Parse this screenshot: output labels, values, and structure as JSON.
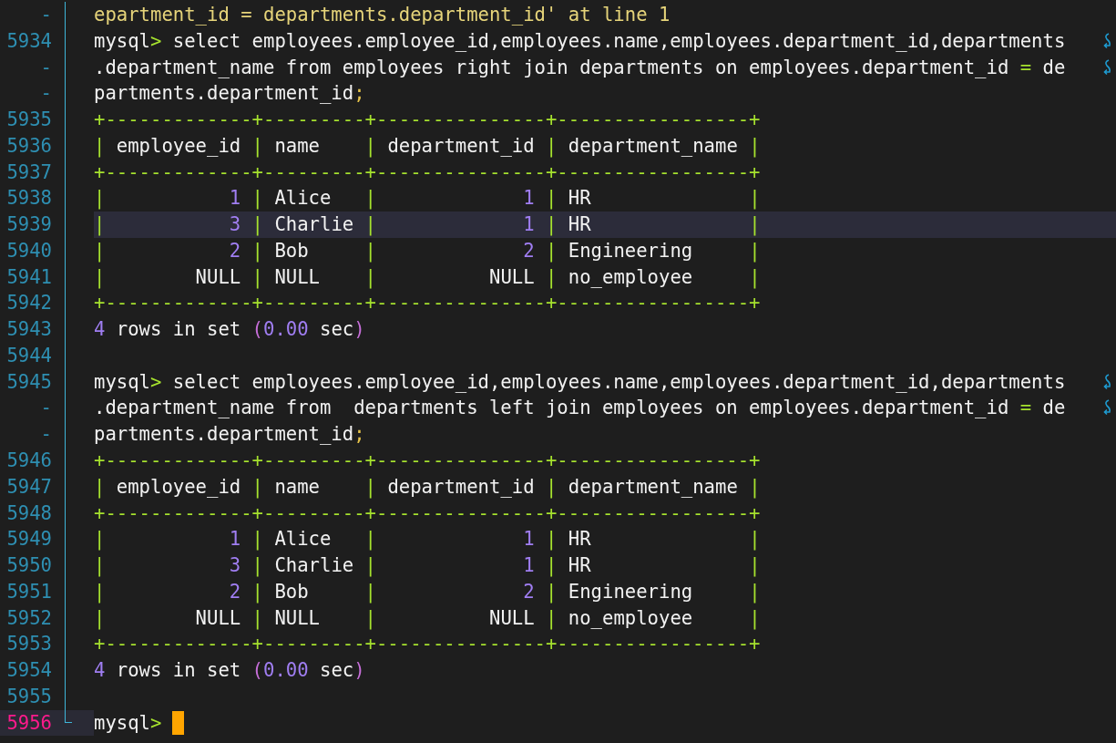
{
  "lines": [
    {
      "number": "-",
      "wrapped": false,
      "highlighted": false,
      "current": false,
      "segments": [
        {
          "text": "epartment_id = departments.department_id' at line 1",
          "kind": "string"
        }
      ]
    },
    {
      "number": "5934",
      "wrapped": true,
      "highlighted": false,
      "current": false,
      "segments": [
        {
          "text": "mysql",
          "kind": "text"
        },
        {
          "text": ">",
          "kind": "prompt"
        },
        {
          "text": " select employees.employee_id,employees.name,employees.department_id,departments",
          "kind": "text"
        }
      ]
    },
    {
      "number": "-",
      "wrapped": true,
      "highlighted": false,
      "current": false,
      "segments": [
        {
          "text": ".department_name from employees right join departments on employees.department_id ",
          "kind": "text"
        },
        {
          "text": "=",
          "kind": "operator"
        },
        {
          "text": " de",
          "kind": "text"
        }
      ]
    },
    {
      "number": "-",
      "wrapped": false,
      "highlighted": false,
      "current": false,
      "segments": [
        {
          "text": "partments.department_id",
          "kind": "text"
        },
        {
          "text": ";",
          "kind": "punct"
        }
      ]
    },
    {
      "number": "5935",
      "wrapped": false,
      "highlighted": false,
      "current": false,
      "segments": [
        {
          "text": "+-------------+---------+---------------+-----------------+",
          "kind": "border"
        }
      ]
    },
    {
      "number": "5936",
      "wrapped": false,
      "highlighted": false,
      "current": false,
      "segments": [
        {
          "text": "| ",
          "kind": "border"
        },
        {
          "text": "employee_id",
          "kind": "text"
        },
        {
          "text": " | ",
          "kind": "border"
        },
        {
          "text": "name   ",
          "kind": "text"
        },
        {
          "text": " | ",
          "kind": "border"
        },
        {
          "text": "department_id",
          "kind": "text"
        },
        {
          "text": " | ",
          "kind": "border"
        },
        {
          "text": "department_name",
          "kind": "text"
        },
        {
          "text": " |",
          "kind": "border"
        }
      ]
    },
    {
      "number": "5937",
      "wrapped": false,
      "highlighted": false,
      "current": false,
      "segments": [
        {
          "text": "+-------------+---------+---------------+-----------------+",
          "kind": "border"
        }
      ]
    },
    {
      "number": "5938",
      "wrapped": false,
      "highlighted": false,
      "current": false,
      "segments": [
        {
          "text": "| ",
          "kind": "border"
        },
        {
          "text": "          1",
          "kind": "number"
        },
        {
          "text": " | ",
          "kind": "border"
        },
        {
          "text": "Alice  ",
          "kind": "text"
        },
        {
          "text": " | ",
          "kind": "border"
        },
        {
          "text": "            1",
          "kind": "number"
        },
        {
          "text": " | ",
          "kind": "border"
        },
        {
          "text": "HR             ",
          "kind": "text"
        },
        {
          "text": " |",
          "kind": "border"
        }
      ]
    },
    {
      "number": "5939",
      "wrapped": false,
      "highlighted": true,
      "current": false,
      "segments": [
        {
          "text": "| ",
          "kind": "border"
        },
        {
          "text": "          3",
          "kind": "number"
        },
        {
          "text": " | ",
          "kind": "border"
        },
        {
          "text": "Charlie",
          "kind": "text"
        },
        {
          "text": " | ",
          "kind": "border"
        },
        {
          "text": "            1",
          "kind": "number"
        },
        {
          "text": " | ",
          "kind": "border"
        },
        {
          "text": "HR             ",
          "kind": "text"
        },
        {
          "text": " |",
          "kind": "border"
        }
      ]
    },
    {
      "number": "5940",
      "wrapped": false,
      "highlighted": false,
      "current": false,
      "segments": [
        {
          "text": "| ",
          "kind": "border"
        },
        {
          "text": "          2",
          "kind": "number"
        },
        {
          "text": " | ",
          "kind": "border"
        },
        {
          "text": "Bob    ",
          "kind": "text"
        },
        {
          "text": " | ",
          "kind": "border"
        },
        {
          "text": "            2",
          "kind": "number"
        },
        {
          "text": " | ",
          "kind": "border"
        },
        {
          "text": "Engineering    ",
          "kind": "text"
        },
        {
          "text": " |",
          "kind": "border"
        }
      ]
    },
    {
      "number": "5941",
      "wrapped": false,
      "highlighted": false,
      "current": false,
      "segments": [
        {
          "text": "| ",
          "kind": "border"
        },
        {
          "text": "       NULL",
          "kind": "text"
        },
        {
          "text": " | ",
          "kind": "border"
        },
        {
          "text": "NULL   ",
          "kind": "text"
        },
        {
          "text": " | ",
          "kind": "border"
        },
        {
          "text": "         NULL",
          "kind": "text"
        },
        {
          "text": " | ",
          "kind": "border"
        },
        {
          "text": "no_employee    ",
          "kind": "text"
        },
        {
          "text": " |",
          "kind": "border"
        }
      ]
    },
    {
      "number": "5942",
      "wrapped": false,
      "highlighted": false,
      "current": false,
      "segments": [
        {
          "text": "+-------------+---------+---------------+-----------------+",
          "kind": "border"
        }
      ]
    },
    {
      "number": "5943",
      "wrapped": false,
      "highlighted": false,
      "current": false,
      "segments": [
        {
          "text": "4",
          "kind": "number"
        },
        {
          "text": " rows in set ",
          "kind": "text"
        },
        {
          "text": "(",
          "kind": "paren"
        },
        {
          "text": "0.00",
          "kind": "number"
        },
        {
          "text": " sec",
          "kind": "text"
        },
        {
          "text": ")",
          "kind": "paren"
        }
      ]
    },
    {
      "number": "5944",
      "wrapped": false,
      "highlighted": false,
      "current": false
    },
    {
      "number": "5945",
      "wrapped": true,
      "highlighted": false,
      "current": false,
      "segments": [
        {
          "text": "mysql",
          "kind": "text"
        },
        {
          "text": ">",
          "kind": "prompt"
        },
        {
          "text": " select employees.employee_id,employees.name,employees.department_id,departments",
          "kind": "text"
        }
      ]
    },
    {
      "number": "-",
      "wrapped": true,
      "highlighted": false,
      "current": false,
      "segments": [
        {
          "text": ".department_name from  departments left join employees on employees.department_id ",
          "kind": "text"
        },
        {
          "text": "=",
          "kind": "operator"
        },
        {
          "text": " de",
          "kind": "text"
        }
      ]
    },
    {
      "number": "-",
      "wrapped": false,
      "highlighted": false,
      "current": false,
      "segments": [
        {
          "text": "partments.department_id",
          "kind": "text"
        },
        {
          "text": ";",
          "kind": "punct"
        }
      ]
    },
    {
      "number": "5946",
      "wrapped": false,
      "highlighted": false,
      "current": false,
      "segments": [
        {
          "text": "+-------------+---------+---------------+-----------------+",
          "kind": "border"
        }
      ]
    },
    {
      "number": "5947",
      "wrapped": false,
      "highlighted": false,
      "current": false,
      "segments": [
        {
          "text": "| ",
          "kind": "border"
        },
        {
          "text": "employee_id",
          "kind": "text"
        },
        {
          "text": " | ",
          "kind": "border"
        },
        {
          "text": "name   ",
          "kind": "text"
        },
        {
          "text": " | ",
          "kind": "border"
        },
        {
          "text": "department_id",
          "kind": "text"
        },
        {
          "text": " | ",
          "kind": "border"
        },
        {
          "text": "department_name",
          "kind": "text"
        },
        {
          "text": " |",
          "kind": "border"
        }
      ]
    },
    {
      "number": "5948",
      "wrapped": false,
      "highlighted": false,
      "current": false,
      "segments": [
        {
          "text": "+-------------+---------+---------------+-----------------+",
          "kind": "border"
        }
      ]
    },
    {
      "number": "5949",
      "wrapped": false,
      "highlighted": false,
      "current": false,
      "segments": [
        {
          "text": "| ",
          "kind": "border"
        },
        {
          "text": "          1",
          "kind": "number"
        },
        {
          "text": " | ",
          "kind": "border"
        },
        {
          "text": "Alice  ",
          "kind": "text"
        },
        {
          "text": " | ",
          "kind": "border"
        },
        {
          "text": "            1",
          "kind": "number"
        },
        {
          "text": " | ",
          "kind": "border"
        },
        {
          "text": "HR             ",
          "kind": "text"
        },
        {
          "text": " |",
          "kind": "border"
        }
      ]
    },
    {
      "number": "5950",
      "wrapped": false,
      "highlighted": false,
      "current": false,
      "segments": [
        {
          "text": "| ",
          "kind": "border"
        },
        {
          "text": "          3",
          "kind": "number"
        },
        {
          "text": " | ",
          "kind": "border"
        },
        {
          "text": "Charlie",
          "kind": "text"
        },
        {
          "text": " | ",
          "kind": "border"
        },
        {
          "text": "            1",
          "kind": "number"
        },
        {
          "text": " | ",
          "kind": "border"
        },
        {
          "text": "HR             ",
          "kind": "text"
        },
        {
          "text": " |",
          "kind": "border"
        }
      ]
    },
    {
      "number": "5951",
      "wrapped": false,
      "highlighted": false,
      "current": false,
      "segments": [
        {
          "text": "| ",
          "kind": "border"
        },
        {
          "text": "          2",
          "kind": "number"
        },
        {
          "text": " | ",
          "kind": "border"
        },
        {
          "text": "Bob    ",
          "kind": "text"
        },
        {
          "text": " | ",
          "kind": "border"
        },
        {
          "text": "            2",
          "kind": "number"
        },
        {
          "text": " | ",
          "kind": "border"
        },
        {
          "text": "Engineering    ",
          "kind": "text"
        },
        {
          "text": " |",
          "kind": "border"
        }
      ]
    },
    {
      "number": "5952",
      "wrapped": false,
      "highlighted": false,
      "current": false,
      "segments": [
        {
          "text": "| ",
          "kind": "border"
        },
        {
          "text": "       NULL",
          "kind": "text"
        },
        {
          "text": " | ",
          "kind": "border"
        },
        {
          "text": "NULL   ",
          "kind": "text"
        },
        {
          "text": " | ",
          "kind": "border"
        },
        {
          "text": "         NULL",
          "kind": "text"
        },
        {
          "text": " | ",
          "kind": "border"
        },
        {
          "text": "no_employee    ",
          "kind": "text"
        },
        {
          "text": " |",
          "kind": "border"
        }
      ]
    },
    {
      "number": "5953",
      "wrapped": false,
      "highlighted": false,
      "current": false,
      "segments": [
        {
          "text": "+-------------+---------+---------------+-----------------+",
          "kind": "border"
        }
      ]
    },
    {
      "number": "5954",
      "wrapped": false,
      "highlighted": false,
      "current": false,
      "segments": [
        {
          "text": "4",
          "kind": "number"
        },
        {
          "text": " rows in set ",
          "kind": "text"
        },
        {
          "text": "(",
          "kind": "paren"
        },
        {
          "text": "0.00",
          "kind": "number"
        },
        {
          "text": " sec",
          "kind": "text"
        },
        {
          "text": ")",
          "kind": "paren"
        }
      ]
    },
    {
      "number": "5955",
      "wrapped": false,
      "highlighted": false,
      "current": false
    },
    {
      "number": "5956",
      "wrapped": false,
      "highlighted": false,
      "current": true,
      "segments": [
        {
          "text": "mysql",
          "kind": "text"
        },
        {
          "text": ">",
          "kind": "prompt"
        }
      ]
    }
  ]
}
